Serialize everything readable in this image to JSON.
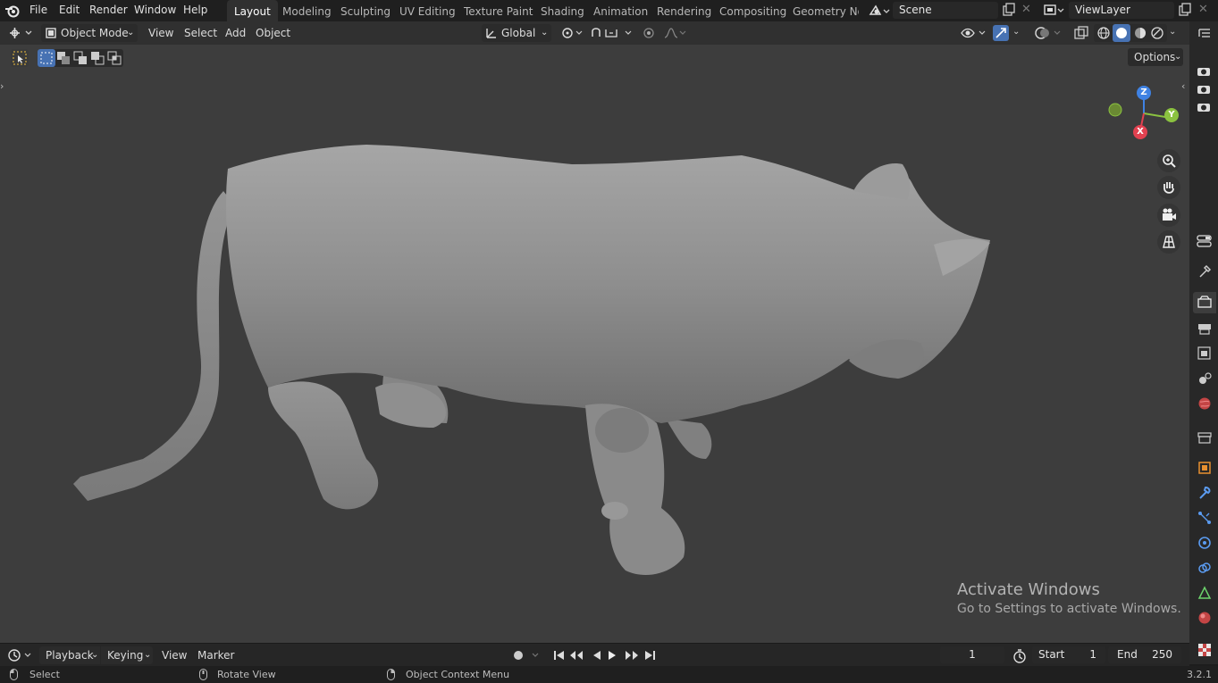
{
  "menus": [
    "File",
    "Edit",
    "Render",
    "Window",
    "Help"
  ],
  "workspace_tabs": [
    "Layout",
    "Modeling",
    "Sculpting",
    "UV Editing",
    "Texture Paint",
    "Shading",
    "Animation",
    "Rendering",
    "Compositing",
    "Geometry Noc"
  ],
  "active_workspace": "Layout",
  "scene": {
    "label": "Scene",
    "view_layer": "ViewLayer"
  },
  "viewport_header": {
    "mode": "Object Mode",
    "menus": [
      "View",
      "Select",
      "Add",
      "Object"
    ],
    "transform_orientation": "Global",
    "options_label": "Options"
  },
  "gizmo": {
    "z": "Z",
    "y": "Y",
    "x": "X"
  },
  "timeline": {
    "menus": [
      "Playback",
      "Keying",
      "View",
      "Marker"
    ],
    "current_frame": "1",
    "start_label": "Start",
    "start_value": "1",
    "end_label": "End",
    "end_value": "250"
  },
  "status": {
    "select": "Select",
    "rotate": "Rotate View",
    "context": "Object Context Menu",
    "version": "3.2.1"
  },
  "watermark": {
    "line1": "Activate Windows",
    "line2": "Go to Settings to activate Windows."
  },
  "colors": {
    "accent": "#4772b3",
    "x_axis": "#e24150",
    "y_axis": "#8bc240",
    "z_axis": "#3f82e3",
    "viewport": "#3d3d3d"
  }
}
